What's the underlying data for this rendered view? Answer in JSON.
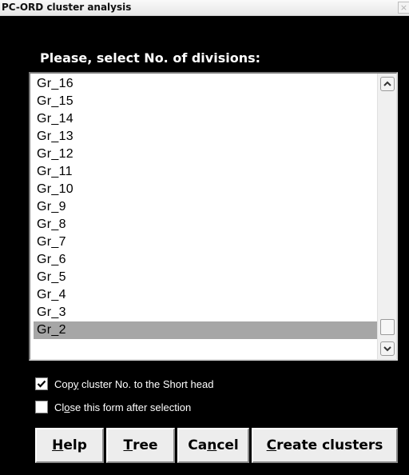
{
  "window": {
    "title": "PC-ORD cluster analysis",
    "close_glyph": "×"
  },
  "prompt": "Please, select No. of divisions:",
  "list": {
    "items": [
      "Gr_16",
      "Gr_15",
      "Gr_14",
      "Gr_13",
      "Gr_12",
      "Gr_11",
      "Gr_10",
      "Gr_9",
      "Gr_8",
      "Gr_7",
      "Gr_6",
      "Gr_5",
      "Gr_4",
      "Gr_3",
      "Gr_2"
    ],
    "selected": "Gr_2",
    "scroll_icons": {
      "up": "chevron-up-icon",
      "down": "chevron-down-icon"
    }
  },
  "options": {
    "copy_cluster": {
      "pre": "Cop",
      "ul": "y",
      "post": " cluster No. to the Short head",
      "checked": true
    },
    "close_form": {
      "pre": "Cl",
      "ul": "o",
      "post": "se this form after selection",
      "checked": false
    }
  },
  "buttons": {
    "help": {
      "pre": "",
      "ul": "H",
      "post": "elp"
    },
    "tree": {
      "pre": "",
      "ul": "T",
      "post": "ree"
    },
    "cancel": {
      "pre": "Ca",
      "ul": "n",
      "post": "cel"
    },
    "create": {
      "pre": "",
      "ul": "C",
      "post": "reate clusters"
    }
  },
  "colors": {
    "background": "#000000",
    "selection": "#a6a6a6",
    "list_bg": "#ffffff",
    "button_face": "#ededed"
  }
}
